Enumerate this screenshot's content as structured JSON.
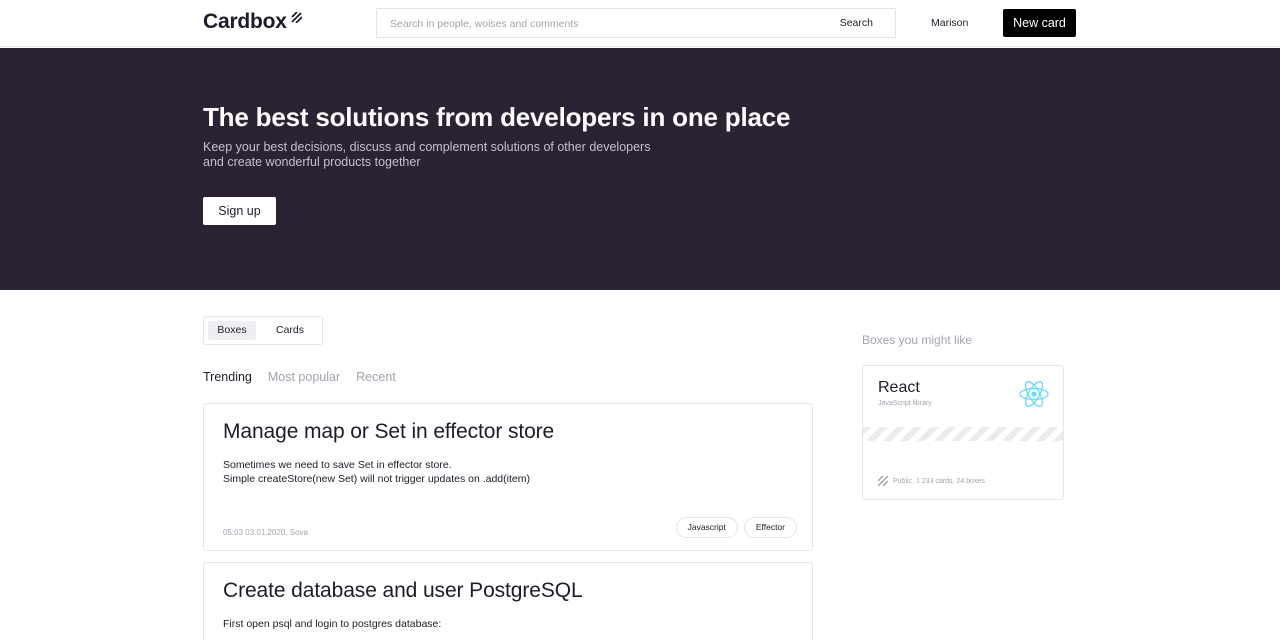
{
  "header": {
    "logo": "Cardbox",
    "search_placeholder": "Search in people, woises and comments",
    "search_button": "Search",
    "user_name": "Marison",
    "new_card": "New card"
  },
  "hero": {
    "title": "The best solutions from developers in one place",
    "subtitle_line1": "Keep your best decisions, discuss and complement solutions of other developers",
    "subtitle_line2": "and create wonderful products together",
    "signup": "Sign up"
  },
  "switcher": {
    "options": [
      {
        "label": "Boxes",
        "active": true
      },
      {
        "label": "Cards",
        "active": false
      }
    ]
  },
  "tabs": [
    {
      "label": "Trending",
      "active": true
    },
    {
      "label": "Most popular",
      "active": false
    },
    {
      "label": "Recent",
      "active": false
    }
  ],
  "cards": [
    {
      "title": "Manage map or Set in effector store",
      "body_line1": "Sometimes we need to save Set in effector store.",
      "body_line2": "Simple createStore(new Set) will not trigger updates on .add(item)",
      "meta": "05:03 03.01.2020, Sova",
      "tags": [
        "Javascript",
        "Effector"
      ]
    },
    {
      "title": "Create database and user PostgreSQL",
      "body_line1": "First open psql and login to postgres database:"
    }
  ],
  "sidebar": {
    "title": "Boxes you might like",
    "box": {
      "name": "React",
      "subtitle": "JavaScript library",
      "icon": "react-icon",
      "icon_color": "#61dafb",
      "footer": "Public, 1 233 cards, 24 boxes"
    }
  },
  "colors": {
    "hero_bg": "#2b2233",
    "accent_button": "#000000",
    "muted_text": "#a5a2ae"
  }
}
